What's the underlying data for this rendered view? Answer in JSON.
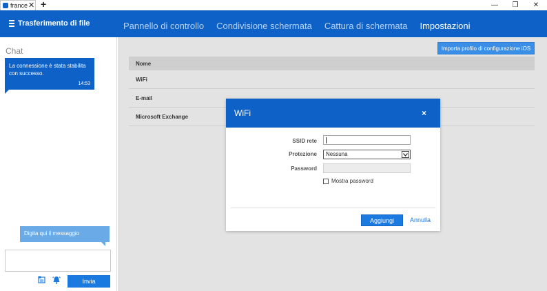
{
  "tab": {
    "label": "france",
    "close": "✕",
    "add": "+"
  },
  "window": {
    "minimize": "—",
    "restore": "❐",
    "close": "✕"
  },
  "header": {
    "brand": "Trasferimento di file",
    "nav": [
      {
        "label": "Pannello di controllo",
        "active": false
      },
      {
        "label": "Condivisione schermata",
        "active": false
      },
      {
        "label": "Cattura di schermata",
        "active": false
      },
      {
        "label": "Impostazioni",
        "active": true
      }
    ]
  },
  "chat": {
    "title": "Chat",
    "message": "La connessione è stata stabilita con successo.",
    "time": "14:53",
    "input_hint": "Digita qui il messaggio",
    "send_label": "Invia"
  },
  "settings": {
    "import_button": "Importa profilo di configurazione iOS",
    "table_header": "Nome",
    "rows": [
      "WiFi",
      "E-mail",
      "Microsoft Exchange"
    ]
  },
  "dialog": {
    "title": "WiFi",
    "close": "×",
    "ssid_label": "SSID rete",
    "ssid_value": "",
    "protection_label": "Protezione",
    "protection_value": "Nessuna",
    "password_label": "Password",
    "show_password_label": "Mostra password",
    "add_button": "Aggiungi",
    "cancel_link": "Annulla"
  },
  "colors": {
    "primary": "#0e62c7",
    "button": "#1b7ae0",
    "hint_bubble": "#6aaae6",
    "content_bg": "#e3e3e3"
  }
}
